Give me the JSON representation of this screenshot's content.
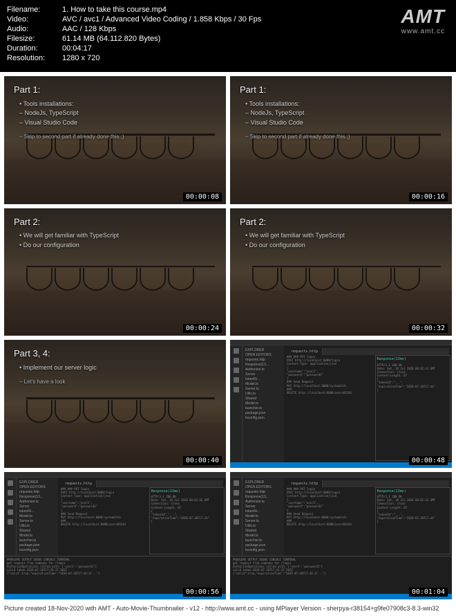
{
  "header": {
    "meta": {
      "filename_label": "Filename:",
      "filename": "1. How to take this course.mp4",
      "video_label": "Video:",
      "video": "AVC / avc1 / Advanced Video Coding / 1.858 Kbps / 30 Fps",
      "audio_label": "Audio:",
      "audio": "AAC / 128 Kbps",
      "filesize_label": "Filesize:",
      "filesize": "61.14 MB (64.112.820 Bytes)",
      "duration_label": "Duration:",
      "duration": "00:04:17",
      "resolution_label": "Resolution:",
      "resolution": "1280 x 720"
    },
    "logo": {
      "text": "AMT",
      "url": "www.amt.cc"
    }
  },
  "thumbs": [
    {
      "type": "bridge",
      "title": "Part 1:",
      "bullets": [
        "• Tools installations:",
        "– NodeJs, TypeScript",
        "– Visual Studio Code"
      ],
      "skip": "– Skip to second part if already done this ;)",
      "timestamp": "00:00:08"
    },
    {
      "type": "bridge",
      "title": "Part 1:",
      "bullets": [
        "• Tools installations:",
        "– NodeJs, TypeScript",
        "– Visual Studio Code"
      ],
      "skip": "– Skip to second part if already done this ;)",
      "timestamp": "00:00:16"
    },
    {
      "type": "bridge",
      "title": "Part 2:",
      "bullets": [
        "• We will get familiar with TypeScript",
        "• Do our configuration"
      ],
      "skip": "",
      "timestamp": "00:00:24"
    },
    {
      "type": "bridge",
      "title": "Part 2:",
      "bullets": [
        "• We will get familiar with TypeScript",
        "• Do our configuration"
      ],
      "skip": "",
      "timestamp": "00:00:32"
    },
    {
      "type": "bridge",
      "title": "Part 3, 4:",
      "bullets": [
        "• Implement our server logic"
      ],
      "skip": "– Let's have a look",
      "timestamp": "00:00:40"
    },
    {
      "type": "code",
      "tab": "requests.http",
      "response": "Response(13ms)",
      "timestamp": "00:00:48"
    },
    {
      "type": "code",
      "tab": "requests.http",
      "response": "Response(13ms)",
      "timestamp": "00:00:56"
    },
    {
      "type": "code",
      "tab": "requests.http",
      "response": "Response(13ms)",
      "timestamp": "00:01:04"
    }
  ],
  "code_content": {
    "explorer_title": "EXPLORER",
    "explorer_items": [
      "OPEN EDITORS",
      "requests.http",
      "Response(13...",
      "Authorizer.ts",
      "Server",
      "tokenRi...",
      "Model.ts",
      "Server.ts",
      "Utils.ts",
      "Shared",
      "Model.ts",
      "launcher.ts",
      "package.json",
      "tsconfig.json"
    ],
    "lines": [
      "### ### PUT login",
      "POST http://localhost:8080/login",
      "Content-Type: application/json",
      "",
      "{",
      "  \"username\":\"user1\",",
      "  \"password\":\"password1\"",
      "}",
      "",
      "### Send Request",
      "PUT http://localhost:8080/systemInfo",
      "",
      "###",
      "DELETE http://localhost:8080/users83244"
    ],
    "terminal_lines": [
      "PROBLEMS  OUTPUT  DEBUG CONSOLE  TERMINAL",
      "got request from someone for /login",
      "AuthorizeOperations called with: {'user1':'password1'}",
      "valid token 2019-07-20T17:43:37.502Z",
      "{\"valid\":true,\"expirationTime\":\"2019-07-20T17:43:37...\"}"
    ],
    "response_lines": [
      "HTTP/1.1 200 OK",
      "Date: Sat, 18 Jul 2020 08:02:42 GMT",
      "Connection: close",
      "Content-Length: 87",
      "",
      "{",
      "  \"tokenId\":\"...\",",
      "  \"expirationTime\":\"2020-07-20T17:43\"",
      "}"
    ]
  },
  "footer": "Picture created 18-Nov-2020 with AMT - Auto-Movie-Thumbnailer - v12 - http://www.amt.cc - using MPlayer Version - sherpya-r38154+g9fe07908c3-8.3-win32"
}
